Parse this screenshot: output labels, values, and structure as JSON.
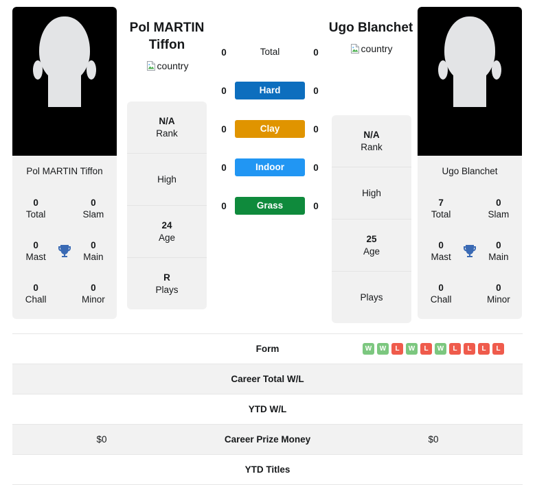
{
  "players": [
    {
      "name": "Pol MARTIN Tiffon",
      "display_name_lines": [
        "Pol MARTIN",
        "Tiffon"
      ],
      "country_alt": "country",
      "card_name": "Pol MARTIN Tiffon",
      "titles": {
        "total_value": "0",
        "total_label": "Total",
        "slam_value": "0",
        "slam_label": "Slam",
        "mast_value": "0",
        "mast_label": "Mast",
        "main_value": "0",
        "main_label": "Main",
        "chall_value": "0",
        "chall_label": "Chall",
        "minor_value": "0",
        "minor_label": "Minor"
      },
      "info": [
        {
          "value": "N/A",
          "label": "Rank"
        },
        {
          "value": "",
          "label": "High"
        },
        {
          "value": "24",
          "label": "Age"
        },
        {
          "value": "R",
          "label": "Plays"
        }
      ]
    },
    {
      "name": "Ugo Blanchet",
      "display_name_lines": [
        "Ugo Blanchet"
      ],
      "country_alt": "country",
      "card_name": "Ugo Blanchet",
      "titles": {
        "total_value": "7",
        "total_label": "Total",
        "slam_value": "0",
        "slam_label": "Slam",
        "mast_value": "0",
        "mast_label": "Mast",
        "main_value": "0",
        "main_label": "Main",
        "chall_value": "0",
        "chall_label": "Chall",
        "minor_value": "0",
        "minor_label": "Minor"
      },
      "info": [
        {
          "value": "N/A",
          "label": "Rank"
        },
        {
          "value": "",
          "label": "High"
        },
        {
          "value": "25",
          "label": "Age"
        },
        {
          "value": "",
          "label": "Plays"
        }
      ]
    }
  ],
  "surfaces": [
    {
      "label": "Total",
      "left": "0",
      "right": "0",
      "color": "transparent",
      "plain": true
    },
    {
      "label": "Hard",
      "left": "0",
      "right": "0",
      "color": "#0d6ebe",
      "plain": false
    },
    {
      "label": "Clay",
      "left": "0",
      "right": "0",
      "color": "#e09400",
      "plain": false
    },
    {
      "label": "Indoor",
      "left": "0",
      "right": "0",
      "color": "#2196f3",
      "plain": false
    },
    {
      "label": "Grass",
      "left": "0",
      "right": "0",
      "color": "#0f8a3c",
      "plain": false
    }
  ],
  "table": {
    "rows": [
      {
        "label": "Form",
        "left": "",
        "right": "",
        "shaded": false,
        "type": "form"
      },
      {
        "label": "Career Total W/L",
        "left": "",
        "right": "",
        "shaded": true,
        "type": "text"
      },
      {
        "label": "YTD W/L",
        "left": "",
        "right": "",
        "shaded": false,
        "type": "text"
      },
      {
        "label": "Career Prize Money",
        "left": "$0",
        "right": "$0",
        "shaded": true,
        "type": "text"
      },
      {
        "label": "YTD Titles",
        "left": "",
        "right": "",
        "shaded": false,
        "type": "text"
      }
    ],
    "form_badges": [
      {
        "result": "W"
      },
      {
        "result": "W"
      },
      {
        "result": "L"
      },
      {
        "result": "W"
      },
      {
        "result": "L"
      },
      {
        "result": "W"
      },
      {
        "result": "L"
      },
      {
        "result": "L"
      },
      {
        "result": "L"
      },
      {
        "result": "L"
      }
    ]
  },
  "colors": {
    "win": "#7cc77f",
    "loss": "#ef5b4c",
    "trophy": "#3a6ab4",
    "card_bg": "#f1f1f1",
    "row_shaded": "#f2f2f2"
  },
  "icons": {
    "trophy": "trophy-icon",
    "broken_image": "broken-image-icon"
  }
}
